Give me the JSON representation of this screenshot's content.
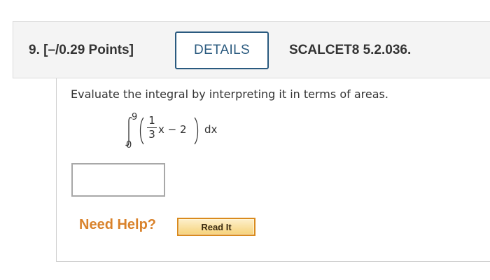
{
  "question": {
    "number_points": "9.  [–/0.29 Points]",
    "details_label": "DETAILS",
    "reference_code": "SCALCET8 5.2.036."
  },
  "body": {
    "prompt": "Evaluate the integral by interpreting it in terms of areas.",
    "integral": {
      "upper_limit": "9",
      "lower_limit": "0",
      "numerator": "1",
      "denominator": "3",
      "expression_rest": "x − 2",
      "differential": "dx"
    },
    "answer": {
      "value": "",
      "placeholder": ""
    }
  },
  "help": {
    "label": "Need Help?",
    "read_it_label": "Read It"
  },
  "colors": {
    "details_accent": "#2a5a7f",
    "need_help": "#d9822b",
    "read_it_border": "#d98a1e"
  }
}
